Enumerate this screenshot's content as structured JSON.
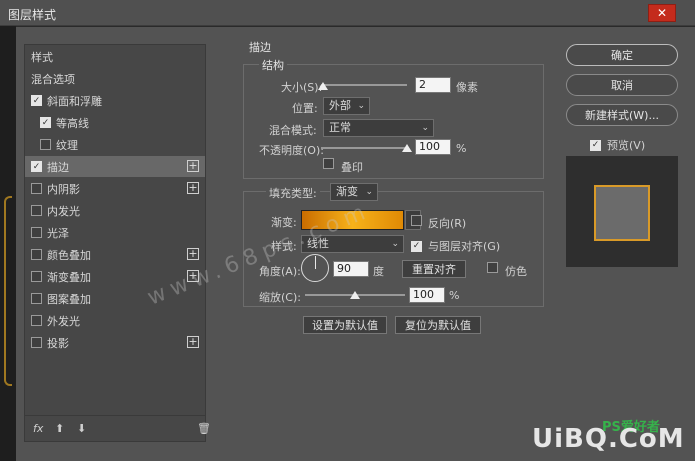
{
  "window": {
    "title": "图层样式"
  },
  "style_list": {
    "items": [
      {
        "label": "样式",
        "checkbox": false,
        "checked": false,
        "plus": false,
        "selected": false
      },
      {
        "label": "混合选项",
        "checkbox": false,
        "checked": false,
        "plus": false,
        "selected": false
      },
      {
        "label": "斜面和浮雕",
        "checkbox": true,
        "checked": true,
        "plus": false,
        "selected": false
      },
      {
        "label": "等高线",
        "checkbox": true,
        "checked": true,
        "plus": false,
        "selected": false
      },
      {
        "label": "纹理",
        "checkbox": true,
        "checked": false,
        "plus": false,
        "selected": false
      },
      {
        "label": "描边",
        "checkbox": true,
        "checked": true,
        "plus": true,
        "selected": true
      },
      {
        "label": "内阴影",
        "checkbox": true,
        "checked": false,
        "plus": true,
        "selected": false
      },
      {
        "label": "内发光",
        "checkbox": true,
        "checked": false,
        "plus": false,
        "selected": false
      },
      {
        "label": "光泽",
        "checkbox": true,
        "checked": false,
        "plus": false,
        "selected": false
      },
      {
        "label": "颜色叠加",
        "checkbox": true,
        "checked": false,
        "plus": true,
        "selected": false
      },
      {
        "label": "渐变叠加",
        "checkbox": true,
        "checked": false,
        "plus": true,
        "selected": false
      },
      {
        "label": "图案叠加",
        "checkbox": true,
        "checked": false,
        "plus": false,
        "selected": false
      },
      {
        "label": "外发光",
        "checkbox": true,
        "checked": false,
        "plus": false,
        "selected": false
      },
      {
        "label": "投影",
        "checkbox": true,
        "checked": false,
        "plus": true,
        "selected": false
      }
    ],
    "fx_label": "fx",
    "up_glyph": "⬆",
    "down_glyph": "⬇",
    "trash_glyph": "🗑"
  },
  "stroke": {
    "section_title": "描边",
    "structure_title": "结构",
    "size_label": "大小(S):",
    "size_value": "2",
    "size_unit": "像素",
    "position_label": "位置:",
    "position_value": "外部",
    "blend_label": "混合模式:",
    "blend_value": "正常",
    "opacity_label": "不透明度(O):",
    "opacity_value": "100",
    "opacity_unit": "%",
    "overprint_label": "叠印",
    "fill_type_label": "填充类型:",
    "fill_type_value": "渐变",
    "gradient_label": "渐变:",
    "reverse_label": "反向(R)",
    "style_label": "样式:",
    "style_value": "线性",
    "align_label": "与图层对齐(G)",
    "angle_label": "角度(A):",
    "angle_value": "90",
    "angle_unit": "度",
    "reset_align_label": "重置对齐",
    "dither_label": "仿色",
    "scale_label": "缩放(C):",
    "scale_value": "100",
    "scale_unit": "%",
    "set_default_label": "设置为默认值",
    "reset_default_label": "复位为默认值",
    "size_slider_fraction": 0.02,
    "opacity_slider_fraction": 1.0,
    "scale_slider_fraction": 0.5,
    "gradient_colors": [
      "#c96d00",
      "#f7b21a",
      "#e08a05"
    ]
  },
  "buttons": {
    "ok": "确定",
    "cancel": "取消",
    "new_style": "新建样式(W)...",
    "preview_label": "预览(V)"
  },
  "overlay": {
    "watermark": "www.68ps.com",
    "brand": "UiBQ.CoM",
    "brand_small": "PS爱好者"
  },
  "colors": {
    "accent_stroke": "#d99a28",
    "close": "#c42b1c"
  }
}
